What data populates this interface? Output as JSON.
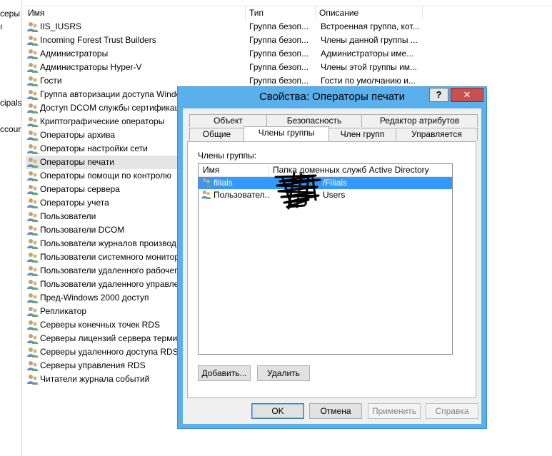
{
  "tree": {
    "items": [
      {
        "label": "серы ,"
      },
      {
        "label": "ı"
      },
      {
        "label": "cipals"
      },
      {
        "label": "ccour"
      }
    ]
  },
  "list": {
    "columns": {
      "name": "Имя",
      "type": "Тип",
      "description": "Описание"
    },
    "rows": [
      {
        "name": "IIS_IUSRS",
        "type": "Группа безоп...",
        "description": "Встроенная группа, кот..."
      },
      {
        "name": "Incoming Forest Trust Builders",
        "type": "Группа безоп...",
        "description": "Члены данной группы ..."
      },
      {
        "name": "Администраторы",
        "type": "Группа безоп...",
        "description": "Администраторы име..."
      },
      {
        "name": "Администраторы Hyper-V",
        "type": "Группа безоп...",
        "description": "Члены этой группы им..."
      },
      {
        "name": "Гости",
        "type": "Группа безоп...",
        "description": "Гости по умолчанию и..."
      },
      {
        "name": "Группа авторизации доступа Windo",
        "type": "",
        "description": ""
      },
      {
        "name": "Доступ DCOM службы сертификац",
        "type": "",
        "description": ""
      },
      {
        "name": "Криптографические операторы",
        "type": "",
        "description": ""
      },
      {
        "name": "Операторы архива",
        "type": "",
        "description": ""
      },
      {
        "name": "Операторы настройки сети",
        "type": "",
        "description": ""
      },
      {
        "name": "Операторы печати",
        "type": "",
        "description": "",
        "selected": true
      },
      {
        "name": "Операторы помощи по контролю",
        "type": "",
        "description": ""
      },
      {
        "name": "Операторы сервера",
        "type": "",
        "description": ""
      },
      {
        "name": "Операторы учета",
        "type": "",
        "description": ""
      },
      {
        "name": "Пользователи",
        "type": "",
        "description": ""
      },
      {
        "name": "Пользователи DCOM",
        "type": "",
        "description": ""
      },
      {
        "name": "Пользователи журналов производ",
        "type": "",
        "description": ""
      },
      {
        "name": "Пользователи системного монитор",
        "type": "",
        "description": ""
      },
      {
        "name": "Пользователи удаленного рабочег",
        "type": "",
        "description": ""
      },
      {
        "name": "Пользователи удаленного управле",
        "type": "",
        "description": ""
      },
      {
        "name": "Пред-Windows 2000 доступ",
        "type": "",
        "description": ""
      },
      {
        "name": "Репликатор",
        "type": "",
        "description": ""
      },
      {
        "name": "Серверы конечных точек RDS",
        "type": "",
        "description": ""
      },
      {
        "name": "Серверы лицензий сервера термин",
        "type": "",
        "description": ""
      },
      {
        "name": "Серверы удаленного доступа RDS",
        "type": "",
        "description": ""
      },
      {
        "name": "Серверы управления RDS",
        "type": "",
        "description": ""
      },
      {
        "name": "Читатели журнала событий",
        "type": "",
        "description": ""
      }
    ]
  },
  "dialog": {
    "title": "Свойства: Операторы печати",
    "help_label": "?",
    "close_label": "✕",
    "tabs_row1": [
      {
        "label": "Объект"
      },
      {
        "label": "Безопасность"
      },
      {
        "label": "Редактор атрибутов"
      }
    ],
    "tabs_row2": [
      {
        "label": "Общие"
      },
      {
        "label": "Члены группы",
        "active": true
      },
      {
        "label": "Член групп"
      },
      {
        "label": "Управляется"
      }
    ],
    "members_label": "Члены группы:",
    "members_columns": {
      "name": "Имя",
      "folder": "Папка доменных служб Active Directory"
    },
    "members": [
      {
        "name": "filials",
        "folder": "/Filials",
        "selected": true
      },
      {
        "name": "Пользовател...",
        "folder": "Users"
      }
    ],
    "add_button": "Добавить...",
    "remove_button": "Удалить",
    "ok_button": "OK",
    "cancel_button": "Отмена",
    "apply_button": "Применить",
    "help_button": "Справка"
  }
}
